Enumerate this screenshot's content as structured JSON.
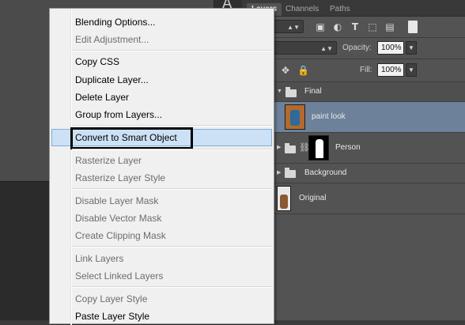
{
  "panel": {
    "tabs": [
      {
        "label": "Layers",
        "active": true
      },
      {
        "label": "Channels",
        "active": false
      },
      {
        "label": "Paths",
        "active": false
      }
    ],
    "filter_value": "nd",
    "blend_mode": "al",
    "opacity_label": "Opacity:",
    "opacity_value": "100%",
    "fill_label": "Fill:",
    "fill_value": "100%",
    "layers": [
      {
        "name": "Final",
        "kind": "group",
        "expanded": true
      },
      {
        "name": "paint look",
        "kind": "layer",
        "selected": true
      },
      {
        "name": "Person",
        "kind": "group-with-mask",
        "expanded": false
      },
      {
        "name": "Background",
        "kind": "group",
        "expanded": false
      },
      {
        "name": "Original",
        "kind": "layer"
      }
    ],
    "selected_color": "#6d819a"
  },
  "context_menu": {
    "items": [
      {
        "label": "Blending Options...",
        "enabled": true
      },
      {
        "label": "Edit Adjustment...",
        "enabled": false
      },
      {
        "label": "Copy CSS",
        "enabled": true
      },
      {
        "label": "Duplicate Layer...",
        "enabled": true
      },
      {
        "label": "Delete Layer",
        "enabled": true
      },
      {
        "label": "Group from Layers...",
        "enabled": true
      },
      {
        "label": "Convert to Smart Object",
        "enabled": true,
        "highlighted": true
      },
      {
        "label": "Rasterize Layer",
        "enabled": false
      },
      {
        "label": "Rasterize Layer Style",
        "enabled": false
      },
      {
        "label": "Disable Layer Mask",
        "enabled": false
      },
      {
        "label": "Disable Vector Mask",
        "enabled": false
      },
      {
        "label": "Create Clipping Mask",
        "enabled": false
      },
      {
        "label": "Link Layers",
        "enabled": false
      },
      {
        "label": "Select Linked Layers",
        "enabled": false
      },
      {
        "label": "Copy Layer Style",
        "enabled": false
      },
      {
        "label": "Paste Layer Style",
        "enabled": true
      }
    ]
  },
  "tool_strip": {
    "text_tool_glyph": "A"
  },
  "colors": {
    "menu_bg": "#f0f0f0",
    "highlight": "#cce1f5",
    "panel_bg": "#535353"
  }
}
